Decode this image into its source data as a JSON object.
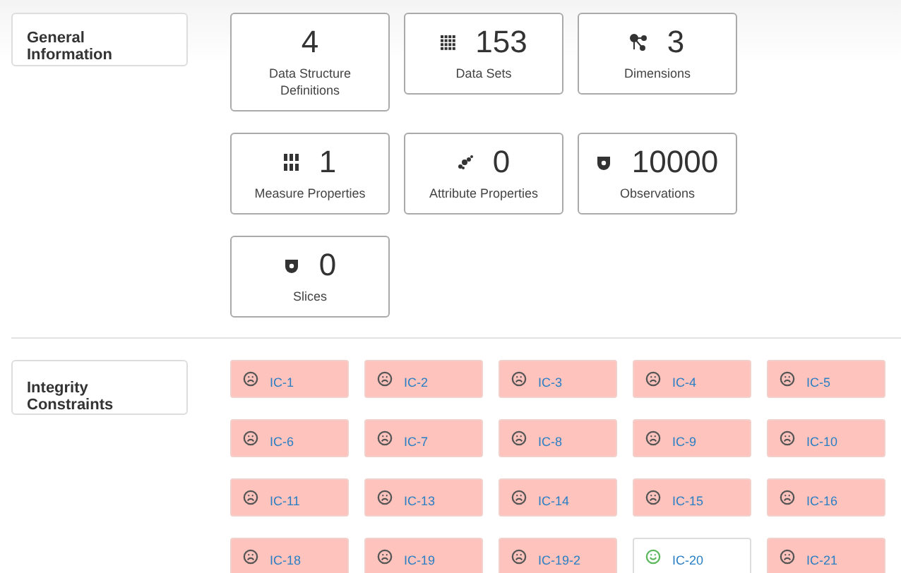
{
  "general": {
    "title": "General Information",
    "stats": [
      {
        "kind": "none",
        "value": "4",
        "label": "Data Structure Definitions"
      },
      {
        "kind": "grid",
        "value": "153",
        "label": "Data Sets"
      },
      {
        "kind": "network",
        "value": "3",
        "label": "Dimensions"
      },
      {
        "kind": "numbers",
        "value": "1",
        "label": "Measure Properties"
      },
      {
        "kind": "bits",
        "value": "0",
        "label": "Attribute Properties"
      },
      {
        "kind": "badge",
        "value": "10000",
        "label": "Observations"
      },
      {
        "kind": "badge",
        "value": "0",
        "label": "Slices"
      }
    ]
  },
  "integrity": {
    "title": "Integrity Constraints",
    "constraints": [
      {
        "label": "IC-1",
        "passed": false
      },
      {
        "label": "IC-2",
        "passed": false
      },
      {
        "label": "IC-3",
        "passed": false
      },
      {
        "label": "IC-4",
        "passed": false
      },
      {
        "label": "IC-5",
        "passed": false
      },
      {
        "label": "IC-6",
        "passed": false
      },
      {
        "label": "IC-7",
        "passed": false
      },
      {
        "label": "IC-8",
        "passed": false
      },
      {
        "label": "IC-9",
        "passed": false
      },
      {
        "label": "IC-10",
        "passed": false
      },
      {
        "label": "IC-11",
        "passed": false
      },
      {
        "label": "IC-13",
        "passed": false
      },
      {
        "label": "IC-14",
        "passed": false
      },
      {
        "label": "IC-15",
        "passed": false
      },
      {
        "label": "IC-16",
        "passed": false
      },
      {
        "label": "IC-18",
        "passed": false
      },
      {
        "label": "IC-19",
        "passed": false
      },
      {
        "label": "IC-19-2",
        "passed": false
      },
      {
        "label": "IC-20",
        "passed": true
      },
      {
        "label": "IC-21",
        "passed": false
      }
    ]
  }
}
